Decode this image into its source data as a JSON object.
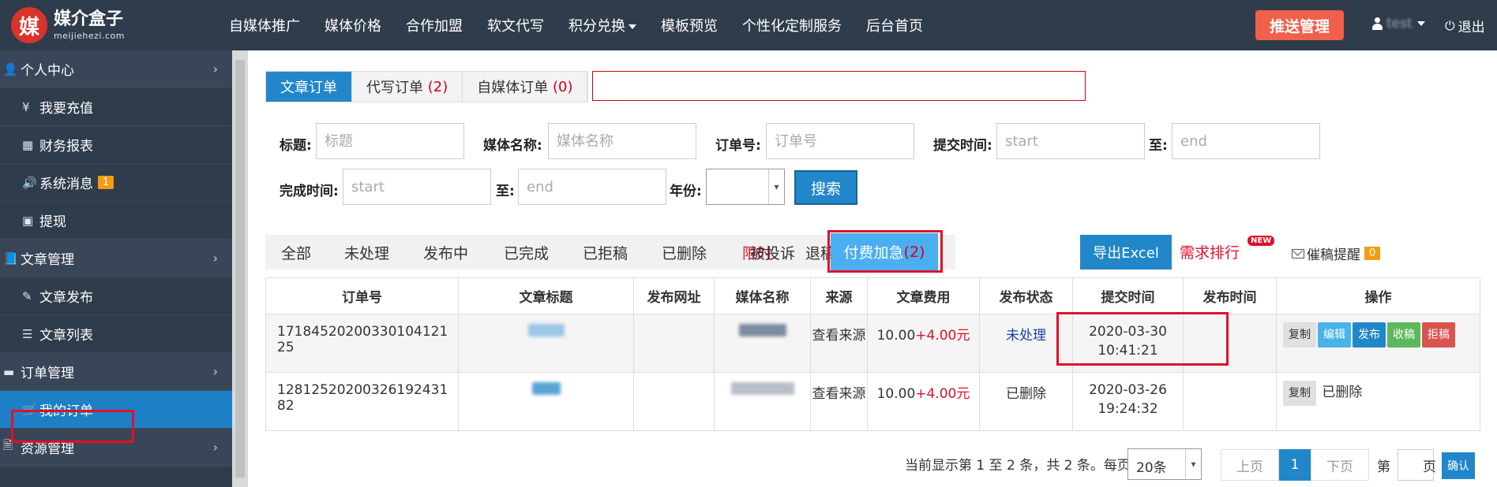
{
  "brand": {
    "logo_char": "媒",
    "name": "媒介盒子",
    "domain": "meijiehezi.com"
  },
  "nav": {
    "items": [
      "自媒体推广",
      "媒体价格",
      "合作加盟",
      "软文代写",
      "积分兑换",
      "模板预览",
      "个性化定制服务",
      "后台首页"
    ],
    "push_btn": "推送管理",
    "user": "test",
    "logout": "退出"
  },
  "sidebar": {
    "personal": "个人中心",
    "recharge": "我要充值",
    "finance": "财务报表",
    "messages": "系统消息",
    "messages_badge": "1",
    "withdraw": "提现",
    "articles": "文章管理",
    "publish": "文章发布",
    "list": "文章列表",
    "orders": "订单管理",
    "my_orders": "我的订单",
    "resources": "资源管理"
  },
  "tabs": [
    {
      "label": "文章订单",
      "count": ""
    },
    {
      "label": "代写订单",
      "count": "(2)"
    },
    {
      "label": "自媒体订单",
      "count": "(0)"
    }
  ],
  "filters": {
    "title_label": "标题:",
    "title_ph": "标题",
    "media_label": "媒体名称:",
    "media_ph": "媒体名称",
    "order_label": "订单号:",
    "order_ph": "订单号",
    "submit_label": "提交时间:",
    "start_ph": "start",
    "to": "至:",
    "end_ph": "end",
    "finish_label": "完成时间:",
    "year_label": "年份:",
    "search_btn": "搜索"
  },
  "status_tabs": {
    "all": "全部",
    "pending": "未处理",
    "publishing": "发布中",
    "done": "已完成",
    "rejected": "已拒稿",
    "deleted": "已删除",
    "limited": "限时",
    "returning": "退稿中",
    "complained": "被投诉",
    "paid": "付费加急",
    "paid_count": "(2)"
  },
  "export_btn": "导出Excel",
  "rank": "需求排行",
  "new_badge": "NEW",
  "remind": "催稿提醒",
  "remind_count": "0",
  "table": {
    "headers": [
      "订单号",
      "文章标题",
      "发布网址",
      "媒体名称",
      "来源",
      "文章费用",
      "发布状态",
      "提交时间",
      "发布时间",
      "操作"
    ],
    "rows": [
      {
        "order_no": "17184520200330104121​25",
        "source": "查看来源",
        "fee": "10.00",
        "fee_extra": "+4.00元",
        "status": "未处理",
        "date": "2020-03-30",
        "time": "10:41:21"
      },
      {
        "order_no": "12812520200326192431​82",
        "source": "查看来源",
        "fee": "10.00",
        "fee_extra": "+4.00元",
        "status": "已删除",
        "date": "2020-03-26",
        "time": "19:24:32"
      }
    ],
    "ops": {
      "copy": "复制",
      "edit": "编辑",
      "publish": "发布",
      "receive": "收稿",
      "reject": "拒稿",
      "deleted": "已删除"
    }
  },
  "pager": {
    "info": "当前显示第 1 至 2 条，共 2 条。每页",
    "per_page": "20条",
    "prev": "上页",
    "current": "1",
    "next": "下页",
    "page_label": "第",
    "page_suffix": "页",
    "confirm": "确认"
  }
}
